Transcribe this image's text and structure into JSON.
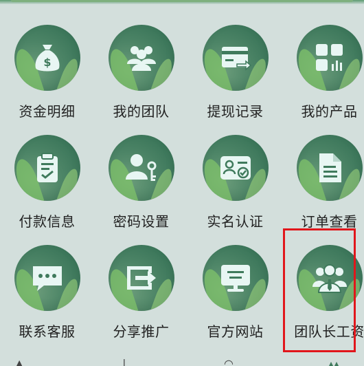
{
  "grid": {
    "items": [
      {
        "label": "资金明细",
        "icon": "money-bag-icon"
      },
      {
        "label": "我的团队",
        "icon": "team-icon"
      },
      {
        "label": "提现记录",
        "icon": "withdraw-card-icon"
      },
      {
        "label": "我的产品",
        "icon": "apps-grid-icon"
      },
      {
        "label": "付款信息",
        "icon": "clipboard-check-icon"
      },
      {
        "label": "密码设置",
        "icon": "user-key-icon"
      },
      {
        "label": "实名认证",
        "icon": "id-card-check-icon"
      },
      {
        "label": "订单查看",
        "icon": "document-icon"
      },
      {
        "label": "联系客服",
        "icon": "chat-bubble-icon"
      },
      {
        "label": "分享推广",
        "icon": "share-icon"
      },
      {
        "label": "官方网站",
        "icon": "website-icon"
      },
      {
        "label": "团队长工资",
        "icon": "team-leader-icon"
      }
    ]
  },
  "colors": {
    "background": "#d3dfdc",
    "circle": "#3f7a5c",
    "icon": "#ffffff",
    "highlight": "#e1161b"
  }
}
